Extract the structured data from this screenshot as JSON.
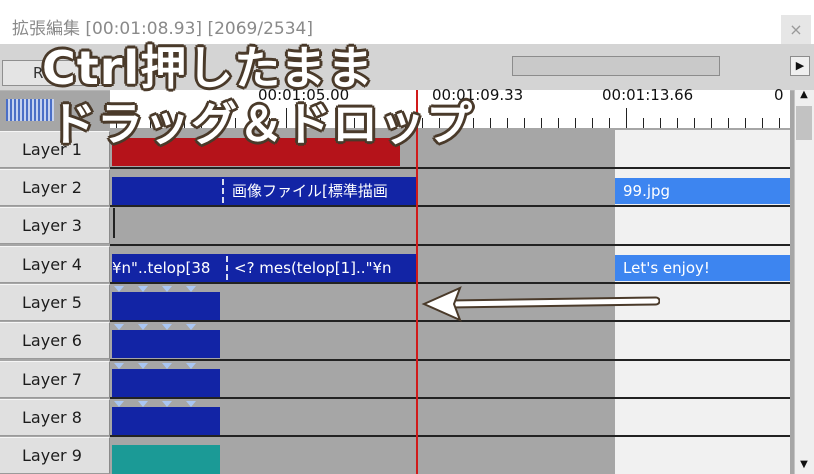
{
  "window": {
    "title": "拡張編集 [00:01:08.93] [2069/2534]",
    "close_label": "×"
  },
  "toolbar": {
    "r_button_label": "R",
    "scroll_right_arrow": "▶"
  },
  "ruler": {
    "labels": [
      "00:01:05.00",
      "00:01:09.33",
      "00:01:13.66",
      "0"
    ]
  },
  "vscroll": {
    "up": "▲",
    "down": "▼"
  },
  "layers": [
    {
      "label": "Layer 1"
    },
    {
      "label": "Layer 2"
    },
    {
      "label": "Layer 3"
    },
    {
      "label": "Layer 4"
    },
    {
      "label": "Layer 5"
    },
    {
      "label": "Layer 6"
    },
    {
      "label": "Layer 7"
    },
    {
      "label": "Layer 8"
    },
    {
      "label": "Layer 9"
    }
  ],
  "objects": {
    "layer2_left_text": "画像ファイル[標準描画",
    "layer2_right_text": "99.jpg",
    "layer4_left_text": "¥n\"..telop[38",
    "layer4_mid_text": "<? mes(telop[1]..\"¥n",
    "layer4_right_text": "Let's enjoy!"
  },
  "overlay": {
    "line1": "Ctrl押したまま",
    "line2": "ドラッグ＆ドロップ"
  },
  "colors": {
    "accent_red": "#b5131a",
    "object_blue": "#1224a5",
    "object_light_blue": "#3d85f0",
    "object_teal": "#1b9a96",
    "cursor": "#d11a1a"
  }
}
